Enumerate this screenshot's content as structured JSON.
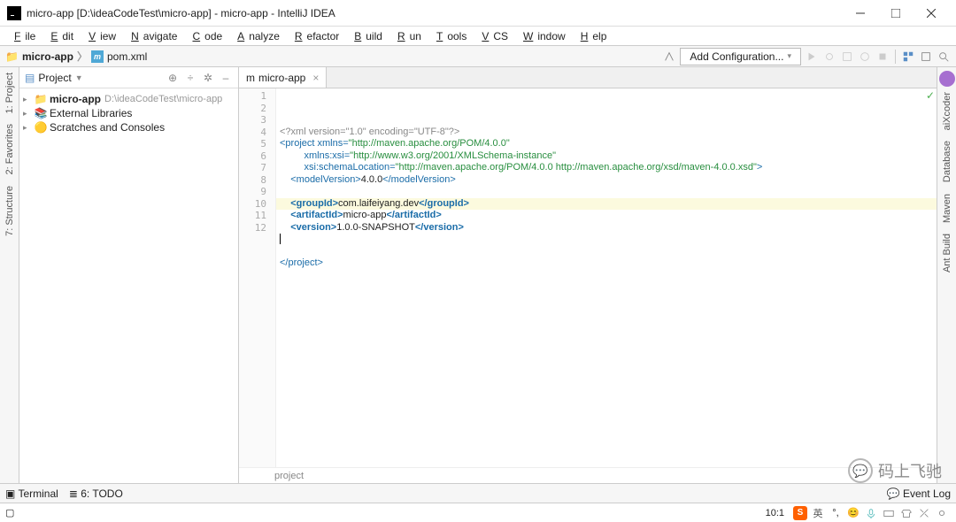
{
  "window": {
    "title": "micro-app [D:\\ideaCodeTest\\micro-app] - micro-app - IntelliJ IDEA"
  },
  "menu": [
    "File",
    "Edit",
    "View",
    "Navigate",
    "Code",
    "Analyze",
    "Refactor",
    "Build",
    "Run",
    "Tools",
    "VCS",
    "Window",
    "Help"
  ],
  "breadcrumb": {
    "root": "micro-app",
    "file": "pom.xml"
  },
  "addConfig": "Add Configuration...",
  "leftRail": [
    "1: Project",
    "2: Favorites",
    "7: Structure"
  ],
  "projectPane": {
    "title": "Project",
    "items": [
      {
        "label": "micro-app",
        "suffix": "D:\\ideaCodeTest\\micro-app",
        "bold": true,
        "icon": "module"
      },
      {
        "label": "External Libraries",
        "icon": "lib"
      },
      {
        "label": "Scratches and Consoles",
        "icon": "scratch"
      }
    ]
  },
  "tab": {
    "label": "micro-app"
  },
  "code": {
    "lines": [
      {
        "html": "<span class='c-gray'>&lt;?xml version=\"1.0\" encoding=\"UTF-8\"?&gt;</span>"
      },
      {
        "html": "<span class='c-tag'>&lt;project</span> <span class='c-attr'>xmlns=</span><span class='c-str'>\"http://maven.apache.org/POM/4.0.0\"</span>"
      },
      {
        "html": "         <span class='c-attr'>xmlns:xsi=</span><span class='c-str'>\"http://www.w3.org/2001/XMLSchema-instance\"</span>"
      },
      {
        "html": "         <span class='c-attr'>xsi:schemaLocation=</span><span class='c-str'>\"http://maven.apache.org/POM/4.0.0 http://maven.apache.org/xsd/maven-4.0.0.xsd\"</span><span class='c-tag'>&gt;</span>"
      },
      {
        "html": "    <span class='c-tag'>&lt;modelVersion&gt;</span>4.0.0<span class='c-tag'>&lt;/modelVersion&gt;</span>"
      },
      {
        "html": " "
      },
      {
        "html": "    <span class='c-tag c-bold'>&lt;groupId&gt;</span>com.laifeiyang.dev<span class='c-tag c-bold'>&lt;/groupId&gt;</span>"
      },
      {
        "html": "    <span class='c-tag c-bold'>&lt;artifactId&gt;</span>micro-app<span class='c-tag c-bold'>&lt;/artifactId&gt;</span>"
      },
      {
        "html": "    <span class='c-tag c-bold'>&lt;version&gt;</span>1.0.0-SNAPSHOT<span class='c-tag c-bold'>&lt;/version&gt;</span>"
      },
      {
        "html": "<span class='caret'></span>"
      },
      {
        "html": " "
      },
      {
        "html": "<span class='c-tag'>&lt;/project&gt;</span>"
      }
    ],
    "highlightLine": 10,
    "crumb": "project"
  },
  "rightRail": [
    "aiXcoder",
    "Database",
    "Maven",
    "Ant Build"
  ],
  "bottom": {
    "terminal": "Terminal",
    "todo": "6: TODO",
    "eventLog": "Event Log"
  },
  "status": {
    "pos": "10:1",
    "ime": "英"
  },
  "watermark": "码上飞驰"
}
